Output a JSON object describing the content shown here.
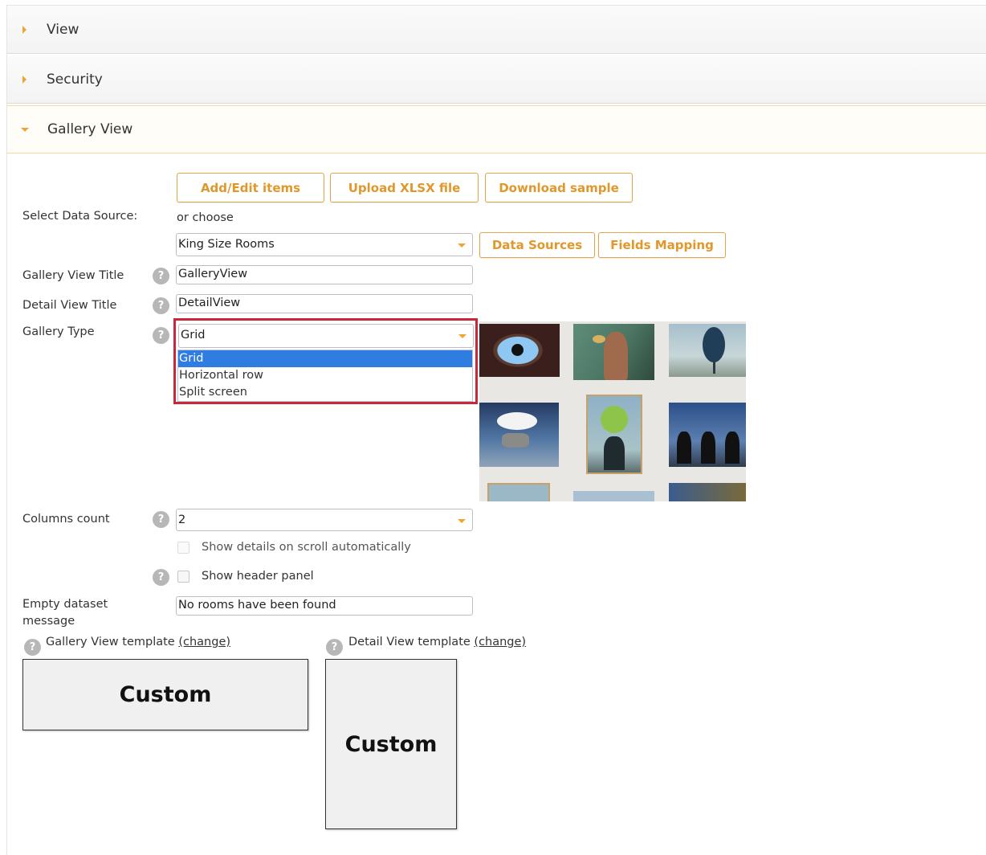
{
  "accordion": [
    {
      "label": "View",
      "state": "collapsed"
    },
    {
      "label": "Security",
      "state": "collapsed"
    },
    {
      "label": "Gallery View",
      "state": "expanded"
    }
  ],
  "buttons": {
    "add_edit": "Add/Edit items",
    "upload": "Upload XLSX file",
    "download": "Download sample",
    "data_sources": "Data Sources",
    "fields_mapping": "Fields Mapping"
  },
  "form": {
    "data_source_label": "Select Data Source:",
    "or_choose": "or choose",
    "data_source_value": "King Size Rooms",
    "gallery_title_label": "Gallery View Title",
    "gallery_title_value": "GalleryView",
    "detail_title_label": "Detail View Title",
    "detail_title_value": "DetailView",
    "gallery_type_label": "Gallery Type",
    "gallery_type_value": "Grid",
    "gallery_type_options": [
      "Grid",
      "Horizontal row",
      "Split screen"
    ],
    "columns_label": "Columns count",
    "columns_value": "2",
    "show_details_label": "Show details on scroll automatically",
    "show_header_label": "Show header panel",
    "empty_label_line1": "Empty dataset",
    "empty_label_line2": "message",
    "empty_value": "No rooms have been found"
  },
  "templates": {
    "gallery_label": "Gallery View template",
    "detail_label": "Detail View template",
    "change": "(change)",
    "gallery_box": "Custom",
    "detail_box": "Custom"
  },
  "help_glyph": "?",
  "colors": {
    "accent": "#f0a330",
    "button_text": "#e0982c",
    "highlight": "#c8283a",
    "selected": "#2f7de1"
  }
}
